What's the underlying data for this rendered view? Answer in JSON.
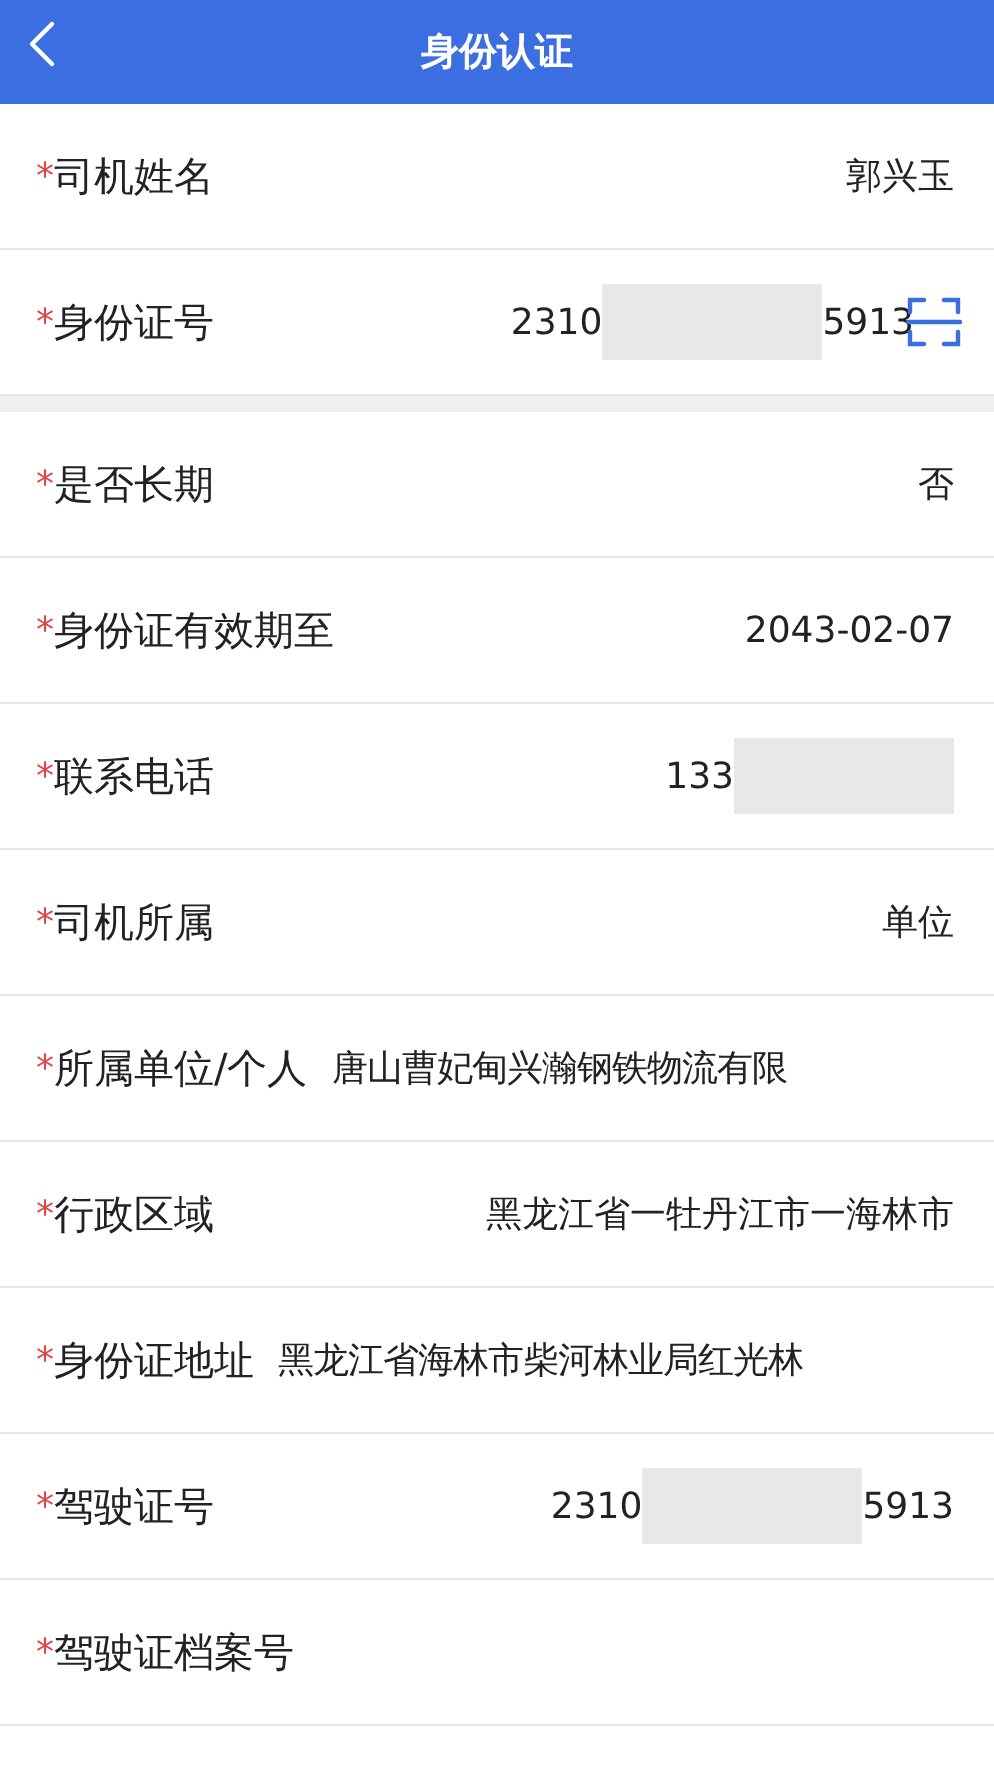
{
  "header": {
    "back_icon": true,
    "title": "身份认证"
  },
  "sections": [
    {
      "rows": [
        {
          "mark": "*",
          "label": "司机姓名",
          "kind": "right",
          "value": "郭兴玉"
        },
        {
          "mark": "*",
          "label": "身份证号",
          "kind": "right",
          "value": "2310",
          "masked": true,
          "value_end": "5913",
          "scan": true
        }
      ]
    },
    {
      "rows": [
        {
          "mark": "*",
          "label": "是否长期",
          "kind": "right",
          "value": "否"
        },
        {
          "mark": "*",
          "label": "身份证有效期至",
          "kind": "right",
          "value": "2043-02-07"
        },
        {
          "mark": "*",
          "label": "联系电话",
          "kind": "right",
          "value": "133",
          "masked": true
        },
        {
          "mark": "*",
          "label": "司机所属",
          "kind": "right",
          "value": "单位"
        },
        {
          "mark": "*",
          "label": "所属单位/个人",
          "kind": "inline",
          "value": "唐山曹妃甸兴瀚钢铁物流有限"
        },
        {
          "mark": "*",
          "label": "行政区域",
          "kind": "right",
          "value": "黑龙江省一牡丹江市一海林市"
        },
        {
          "mark": "*",
          "label": "身份证地址",
          "kind": "inline",
          "value": "黑龙江省海林市柴河林业局红光林"
        },
        {
          "mark": "*",
          "label": "驾驶证号",
          "kind": "right",
          "value": "2310",
          "masked": true,
          "value_end": "5913"
        },
        {
          "mark": "*",
          "label": "驾驶证档案号",
          "kind": "right"
        }
      ]
    }
  ]
}
